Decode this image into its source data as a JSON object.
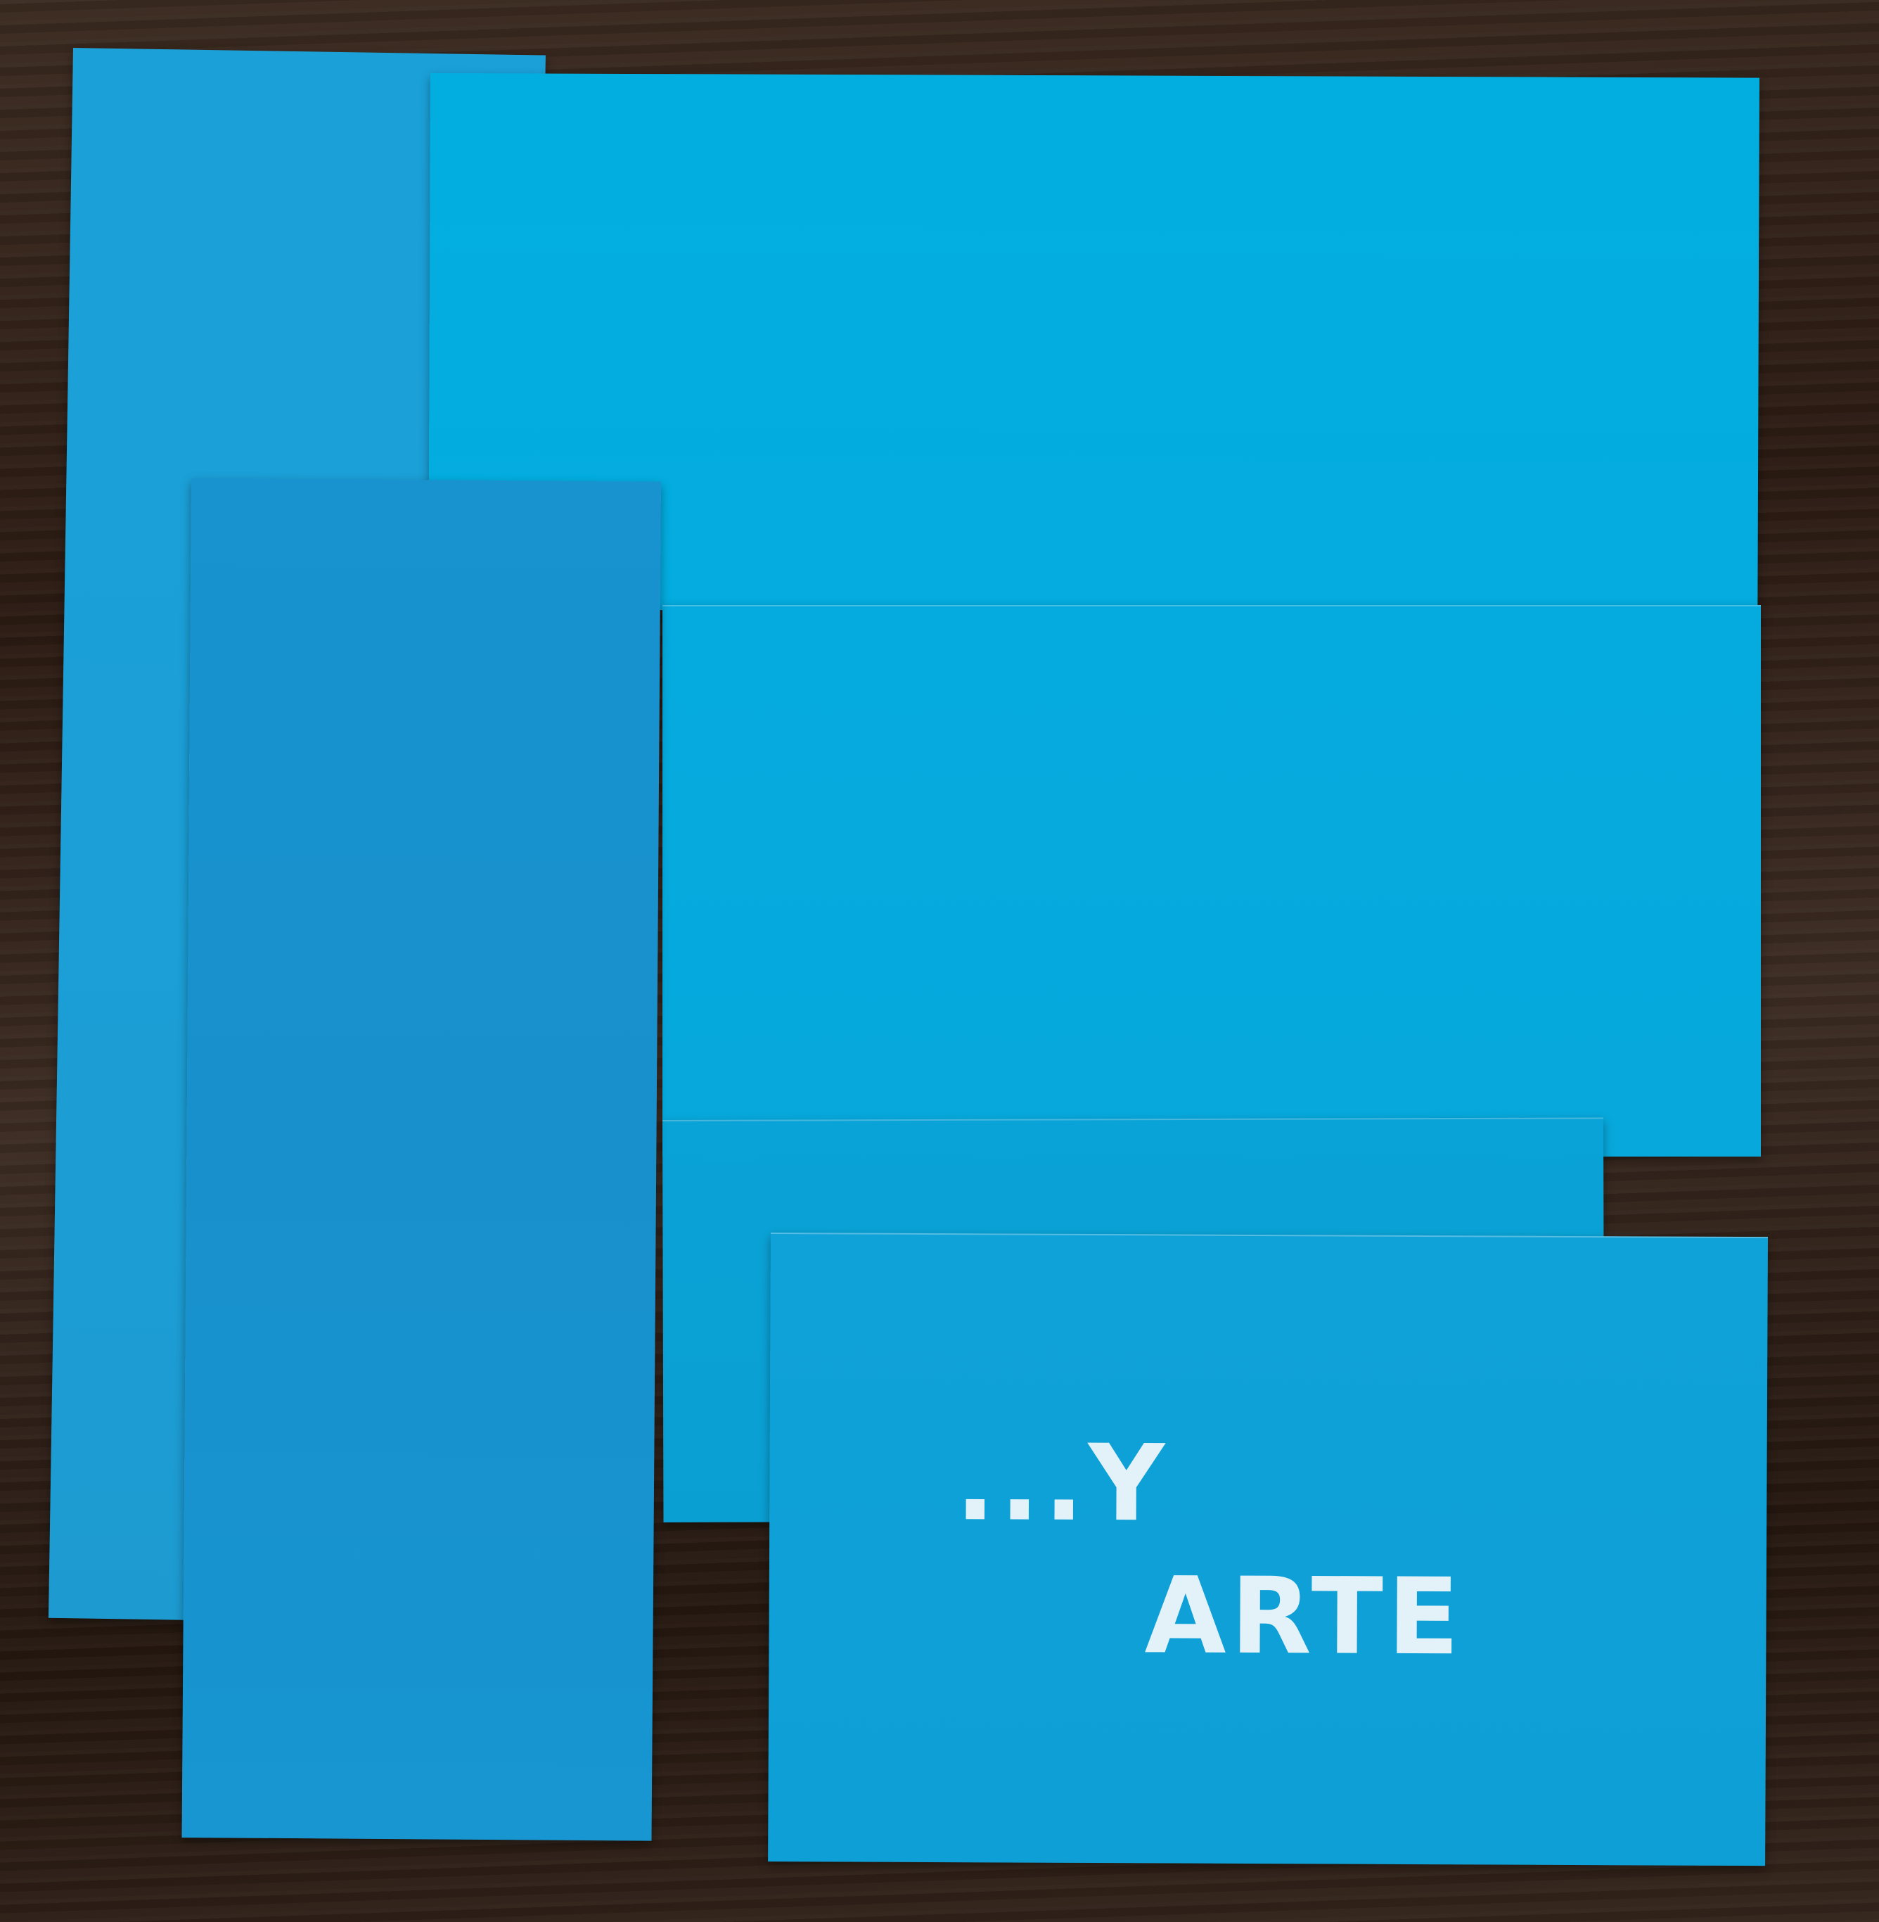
{
  "artwork": {
    "title_line_1": "...Y",
    "title_line_2": "ARTE"
  },
  "colors": {
    "background_wood": "#2b1c14",
    "paper_light_blue": "#04acdf",
    "paper_mid_blue": "#1ba0d8",
    "paper_dark_blue": "#1890cc",
    "title_text": "#e3f2f8"
  }
}
